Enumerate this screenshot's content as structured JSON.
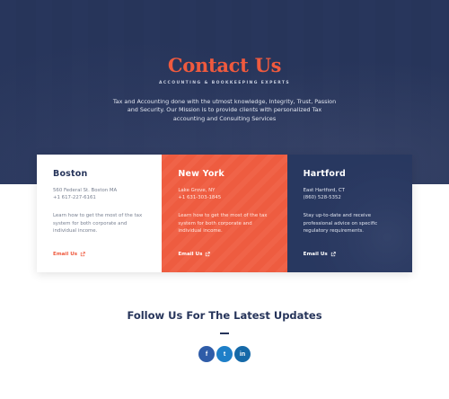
{
  "hero": {
    "title": "Contact Us",
    "subtitle": "ACCOUNTING & BOOKKEEPING EXPERTS",
    "text": "Tax and Accounting done with the utmost knowledge, Integrity, Trust, Passion and Security. Our Mission is to provide clients with personalized Tax accounting and Consulting Services"
  },
  "offices": [
    {
      "city": "Boston",
      "address_line1": "560 Federal St. Boston MA",
      "address_line2": "+1 617-227-6161",
      "description": "Learn how to get the most of the tax system for both corporate and individual income.",
      "email_label": "Email Us"
    },
    {
      "city": "New York",
      "address_line1": "Lake Grove, NY",
      "address_line2": "+1 631-303-1845",
      "description": "Learn how to get the most of the tax system for both corporate and individual income.",
      "email_label": "Email Us"
    },
    {
      "city": "Hartford",
      "address_line1": "East Hartford, CT",
      "address_line2": "(860) 528-5352",
      "description": "Stay up-to-date and receive professional advice on specific regulatory requirements.",
      "email_label": "Email Us"
    }
  ],
  "follow": {
    "heading": "Follow Us For The Latest Updates",
    "socials": [
      {
        "icon": "facebook-icon",
        "glyph": "f"
      },
      {
        "icon": "twitter-icon",
        "glyph": "t"
      },
      {
        "icon": "linkedin-icon",
        "glyph": "in"
      }
    ]
  },
  "colors": {
    "navy": "#26345a",
    "accent": "#ef5a3e",
    "white": "#ffffff"
  }
}
